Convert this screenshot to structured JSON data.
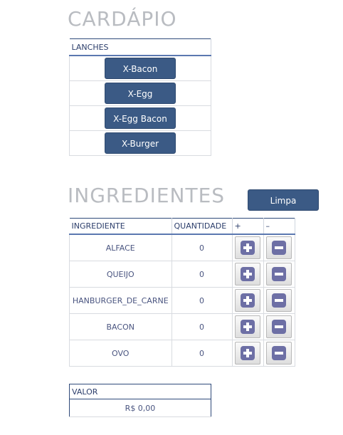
{
  "menu": {
    "title": "CARDÁPIO",
    "header": "LANCHES",
    "items": [
      "X-Bacon",
      "X-Egg",
      "X-Egg Bacon",
      "X-Burger"
    ]
  },
  "ingredients": {
    "title": "INGREDIENTES",
    "clear_label": "Limpa",
    "headers": {
      "name": "INGREDIENTE",
      "qty": "QUANTIDADE",
      "plus": "+",
      "minus": "–"
    },
    "rows": [
      {
        "name": "ALFACE",
        "qty": "0"
      },
      {
        "name": "QUEIJO",
        "qty": "0"
      },
      {
        "name": "HANBURGER_DE_CARNE",
        "qty": "0"
      },
      {
        "name": "BACON",
        "qty": "0"
      },
      {
        "name": "OVO",
        "qty": "0"
      }
    ]
  },
  "total": {
    "header": "VALOR",
    "value": "R$ 0,00"
  },
  "colors": {
    "button": "#3b5a85",
    "heading": "#b9bcc1",
    "icon": "#6d6fa5"
  },
  "icons": {
    "plus": "plus-icon",
    "minus": "minus-icon"
  }
}
